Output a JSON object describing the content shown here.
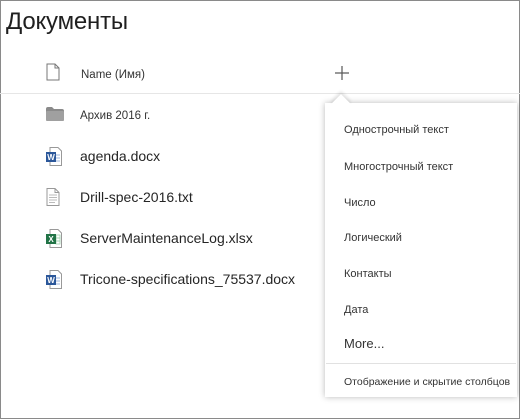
{
  "page": {
    "title": "Документы"
  },
  "header": {
    "name_column_label": "Name (Имя)",
    "add_column_icon": "plus-icon"
  },
  "colors": {
    "word_blue": "#2b579a",
    "excel_green": "#217346",
    "folder_gray": "#8a8a8a"
  },
  "files": [
    {
      "name": "Архив 2016 г.",
      "type": "folder",
      "icon": "folder-icon"
    },
    {
      "name": "agenda.docx",
      "type": "word",
      "icon": "word-doc-icon"
    },
    {
      "name": "Drill-spec-2016.txt",
      "type": "text",
      "icon": "text-file-icon"
    },
    {
      "name": "ServerMaintenanceLog.xlsx",
      "type": "excel",
      "icon": "excel-file-icon"
    },
    {
      "name": "Tricone-specifications_75537.docx",
      "type": "word",
      "icon": "word-doc-icon"
    }
  ],
  "column_menu": {
    "items": [
      "Однострочный текст",
      "Многострочный текст",
      "Число",
      "Логический",
      "Контакты",
      "Дата",
      "More..."
    ],
    "footer": "Отображение и скрытие столбцов"
  }
}
